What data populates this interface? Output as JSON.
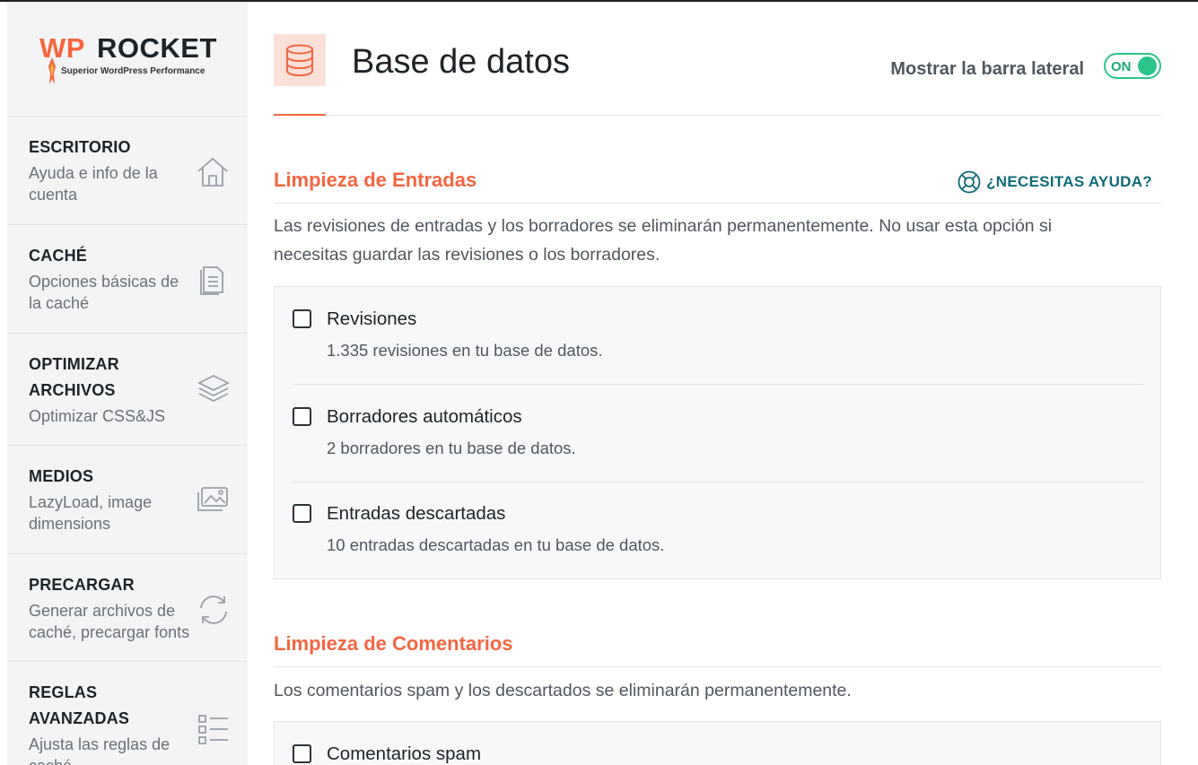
{
  "logo": {
    "wp": "WP",
    "rocket": "ROCKET",
    "tagline": "Superior WordPress Performance"
  },
  "sidebar": {
    "items": [
      {
        "title": "ESCRITORIO",
        "desc": "Ayuda e info de la cuenta",
        "icon": "home-icon"
      },
      {
        "title": "CACHÉ",
        "desc": "Opciones básicas de la caché",
        "icon": "document-icon"
      },
      {
        "title": "OPTIMIZAR ARCHIVOS",
        "desc": "Optimizar CSS&JS",
        "icon": "layers-icon"
      },
      {
        "title": "MEDIOS",
        "desc": "LazyLoad, image dimensions",
        "icon": "images-icon"
      },
      {
        "title": "PRECARGAR",
        "desc": "Generar archivos de caché, precargar fonts",
        "icon": "refresh-icon"
      },
      {
        "title": "REGLAS AVANZADAS",
        "desc": "Ajusta las reglas de caché",
        "icon": "list-icon"
      }
    ]
  },
  "header": {
    "title": "Base de datos",
    "icon": "database-icon",
    "sidebar_toggle_label": "Mostrar la barra lateral",
    "toggle_state": "ON"
  },
  "sections": {
    "posts": {
      "title": "Limpieza de Entradas",
      "help_label": "¿NECESITAS AYUDA?",
      "desc_line1": "Las revisiones de entradas y los borradores se eliminarán permanentemente. No usar esta opción si",
      "desc_line2": "necesitas guardar las revisiones o los borradores.",
      "options": [
        {
          "label": "Revisiones",
          "desc": "1.335 revisiones en tu base de datos."
        },
        {
          "label": "Borradores automáticos",
          "desc": "2 borradores en tu base de datos."
        },
        {
          "label": "Entradas descartadas",
          "desc": "10 entradas descartadas en tu base de datos."
        }
      ]
    },
    "comments": {
      "title": "Limpieza de Comentarios",
      "desc": "Los comentarios spam y los descartados se eliminarán permanentemente.",
      "options": [
        {
          "label": "Comentarios spam"
        }
      ]
    }
  },
  "colors": {
    "accent": "#f56640",
    "toggle": "#2bc48a",
    "help": "#0e6b78"
  }
}
